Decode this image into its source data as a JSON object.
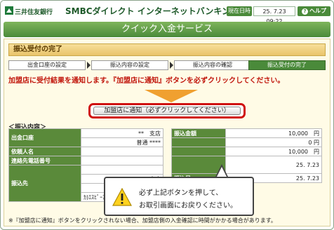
{
  "header": {
    "bank_name": "三井住友銀行",
    "service_name": "SMBCダイレクト インターネットバンキング",
    "datetime_label": "現在日時",
    "datetime_value": "25. 7.23 09:22",
    "help_label": "ヘルプ"
  },
  "banner_title": "クイック入金サービス",
  "section_title": "振込受付の完了",
  "steps": [
    {
      "label": "出金口座の設定",
      "active": false
    },
    {
      "label": "振込内容の設定",
      "active": false
    },
    {
      "label": "振込内容の確認",
      "active": false
    },
    {
      "label": "振込受付の完了",
      "active": true
    }
  ],
  "notice": "加盟店に受付結果を通知します。『加盟店に通知』ボタンを必ずクリックしてください。",
  "notify_button_label": "加盟店に通知（必ずクリックしてください）",
  "detail_title": "＜振込内容＞",
  "left_rows": [
    {
      "label": "出金口座",
      "lines": [
        "**　支店",
        "普通 ****"
      ]
    },
    {
      "label": "依頼人名",
      "lines": [
        ""
      ]
    },
    {
      "label": "連絡先電話番号",
      "lines": [
        ""
      ]
    },
    {
      "label": "振込先",
      "lines": [
        "",
        "**　支店",
        "普通 ****",
        "ｶ)ｴｽﾋﾟｰｱｲﾈｵﾄﾚｰﾄﾞｼﾖｳｹﾝ"
      ]
    }
  ],
  "right_rows": [
    {
      "label": "振込金額",
      "value": "10,000　円"
    },
    {
      "label": "",
      "value": "0 円"
    },
    {
      "label": "",
      "value": "10,000　円"
    },
    {
      "label": "",
      "value": "25. 7.23"
    },
    {
      "label": "振込日",
      "value": "25. 7.23"
    }
  ],
  "footnote": "※『加盟店に通知』ボタンをクリックされない場合、加盟店側の入金確認に時間がかかる場合があります。",
  "callout": {
    "line1": "必ず上記ボタンを押して、",
    "line2": "お取引画面にお戻りください。"
  }
}
